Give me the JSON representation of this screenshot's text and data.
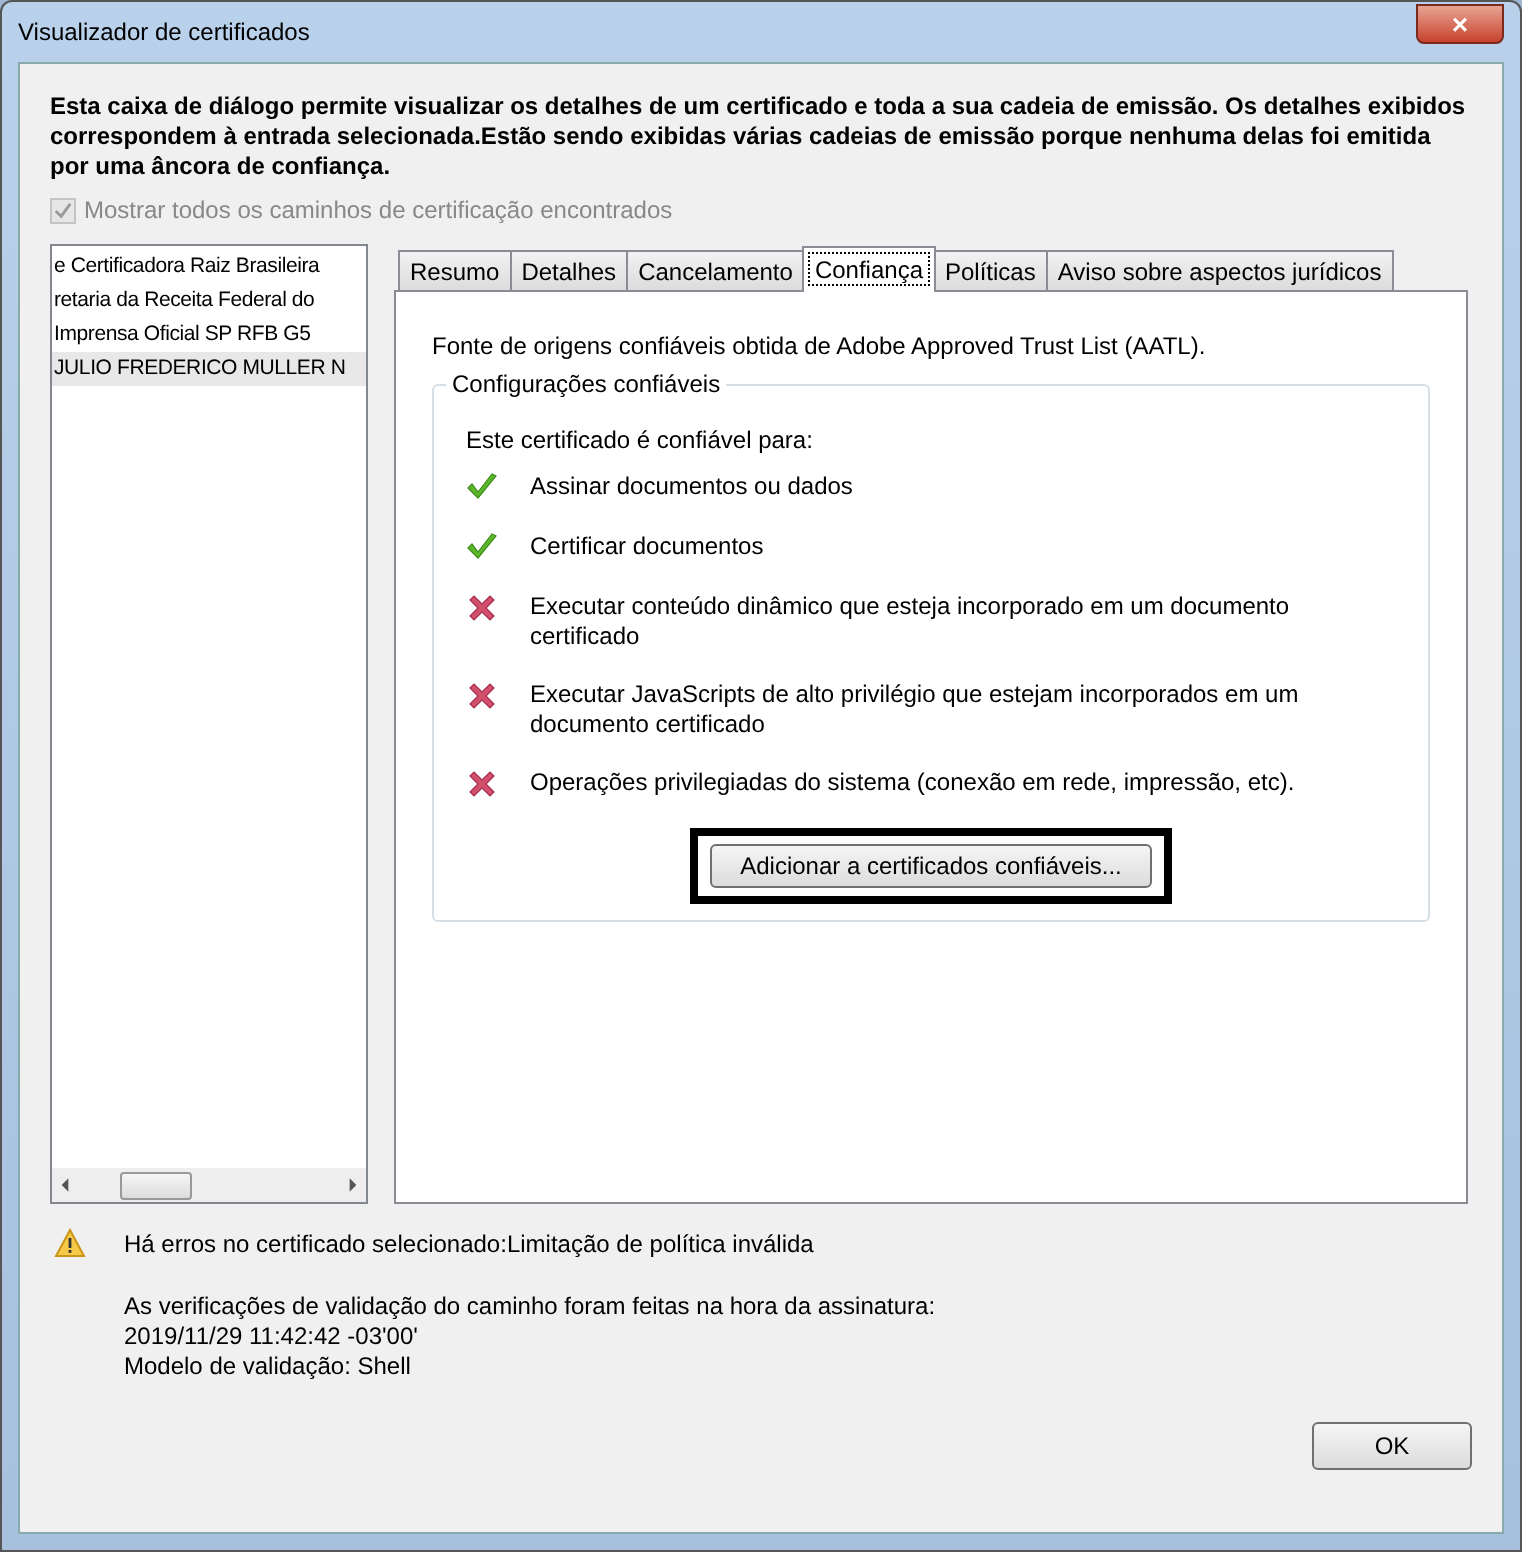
{
  "window": {
    "title": "Visualizador de certificados",
    "close": "×"
  },
  "intro": "Esta caixa de diálogo permite visualizar os detalhes de um certificado e toda a sua cadeia de emissão. Os detalhes exibidos correspondem à entrada selecionada.Estão sendo exibidas várias cadeias de emissão porque nenhuma delas foi emitida por uma âncora de confiança.",
  "show_all_paths": {
    "label": "Mostrar todos os caminhos de certificação encontrados",
    "checked": true,
    "disabled": true
  },
  "chain": [
    {
      "label": "e Certificadora Raiz Brasileira",
      "selected": false
    },
    {
      "label": "retaria da Receita Federal do",
      "selected": false
    },
    {
      "label": "Imprensa Oficial SP RFB G5",
      "selected": false
    },
    {
      "label": "JULIO FREDERICO MULLER N",
      "selected": true
    }
  ],
  "tabs": [
    {
      "label": "Resumo",
      "selected": false
    },
    {
      "label": "Detalhes",
      "selected": false
    },
    {
      "label": "Cancelamento",
      "selected": false
    },
    {
      "label": "Confiança",
      "selected": true
    },
    {
      "label": "Políticas",
      "selected": false
    },
    {
      "label": "Aviso sobre aspectos jurídicos",
      "selected": false
    }
  ],
  "trust": {
    "source": "Fonte de origens confiáveis obtida de Adobe Approved Trust List (AATL).",
    "group_title": "Configurações confiáveis",
    "intro": "Este certificado é confiável para:",
    "items": [
      {
        "label": "Assinar documentos ou dados",
        "allowed": true
      },
      {
        "label": "Certificar documentos",
        "allowed": true
      },
      {
        "label": "Executar conteúdo dinâmico que esteja incorporado em um documento certificado",
        "allowed": false
      },
      {
        "label": "Executar JavaScripts de alto privilégio que estejam incorporados em um documento certificado",
        "allowed": false
      },
      {
        "label": "Operações privilegiadas do sistema (conexão em rede, impressão, etc).",
        "allowed": false
      }
    ],
    "add_button": {
      "label": "Adicionar a certificados confiáveis...",
      "highlighted": true
    }
  },
  "status": {
    "warning": "Há erros no certificado selecionado:Limitação de política inválida",
    "lines": [
      "As verificações de validação do caminho foram feitas na hora da assinatura:",
      "2019/11/29 11:42:42 -03'00'",
      "Modelo de validação: Shell"
    ]
  },
  "ok_button": "OK"
}
